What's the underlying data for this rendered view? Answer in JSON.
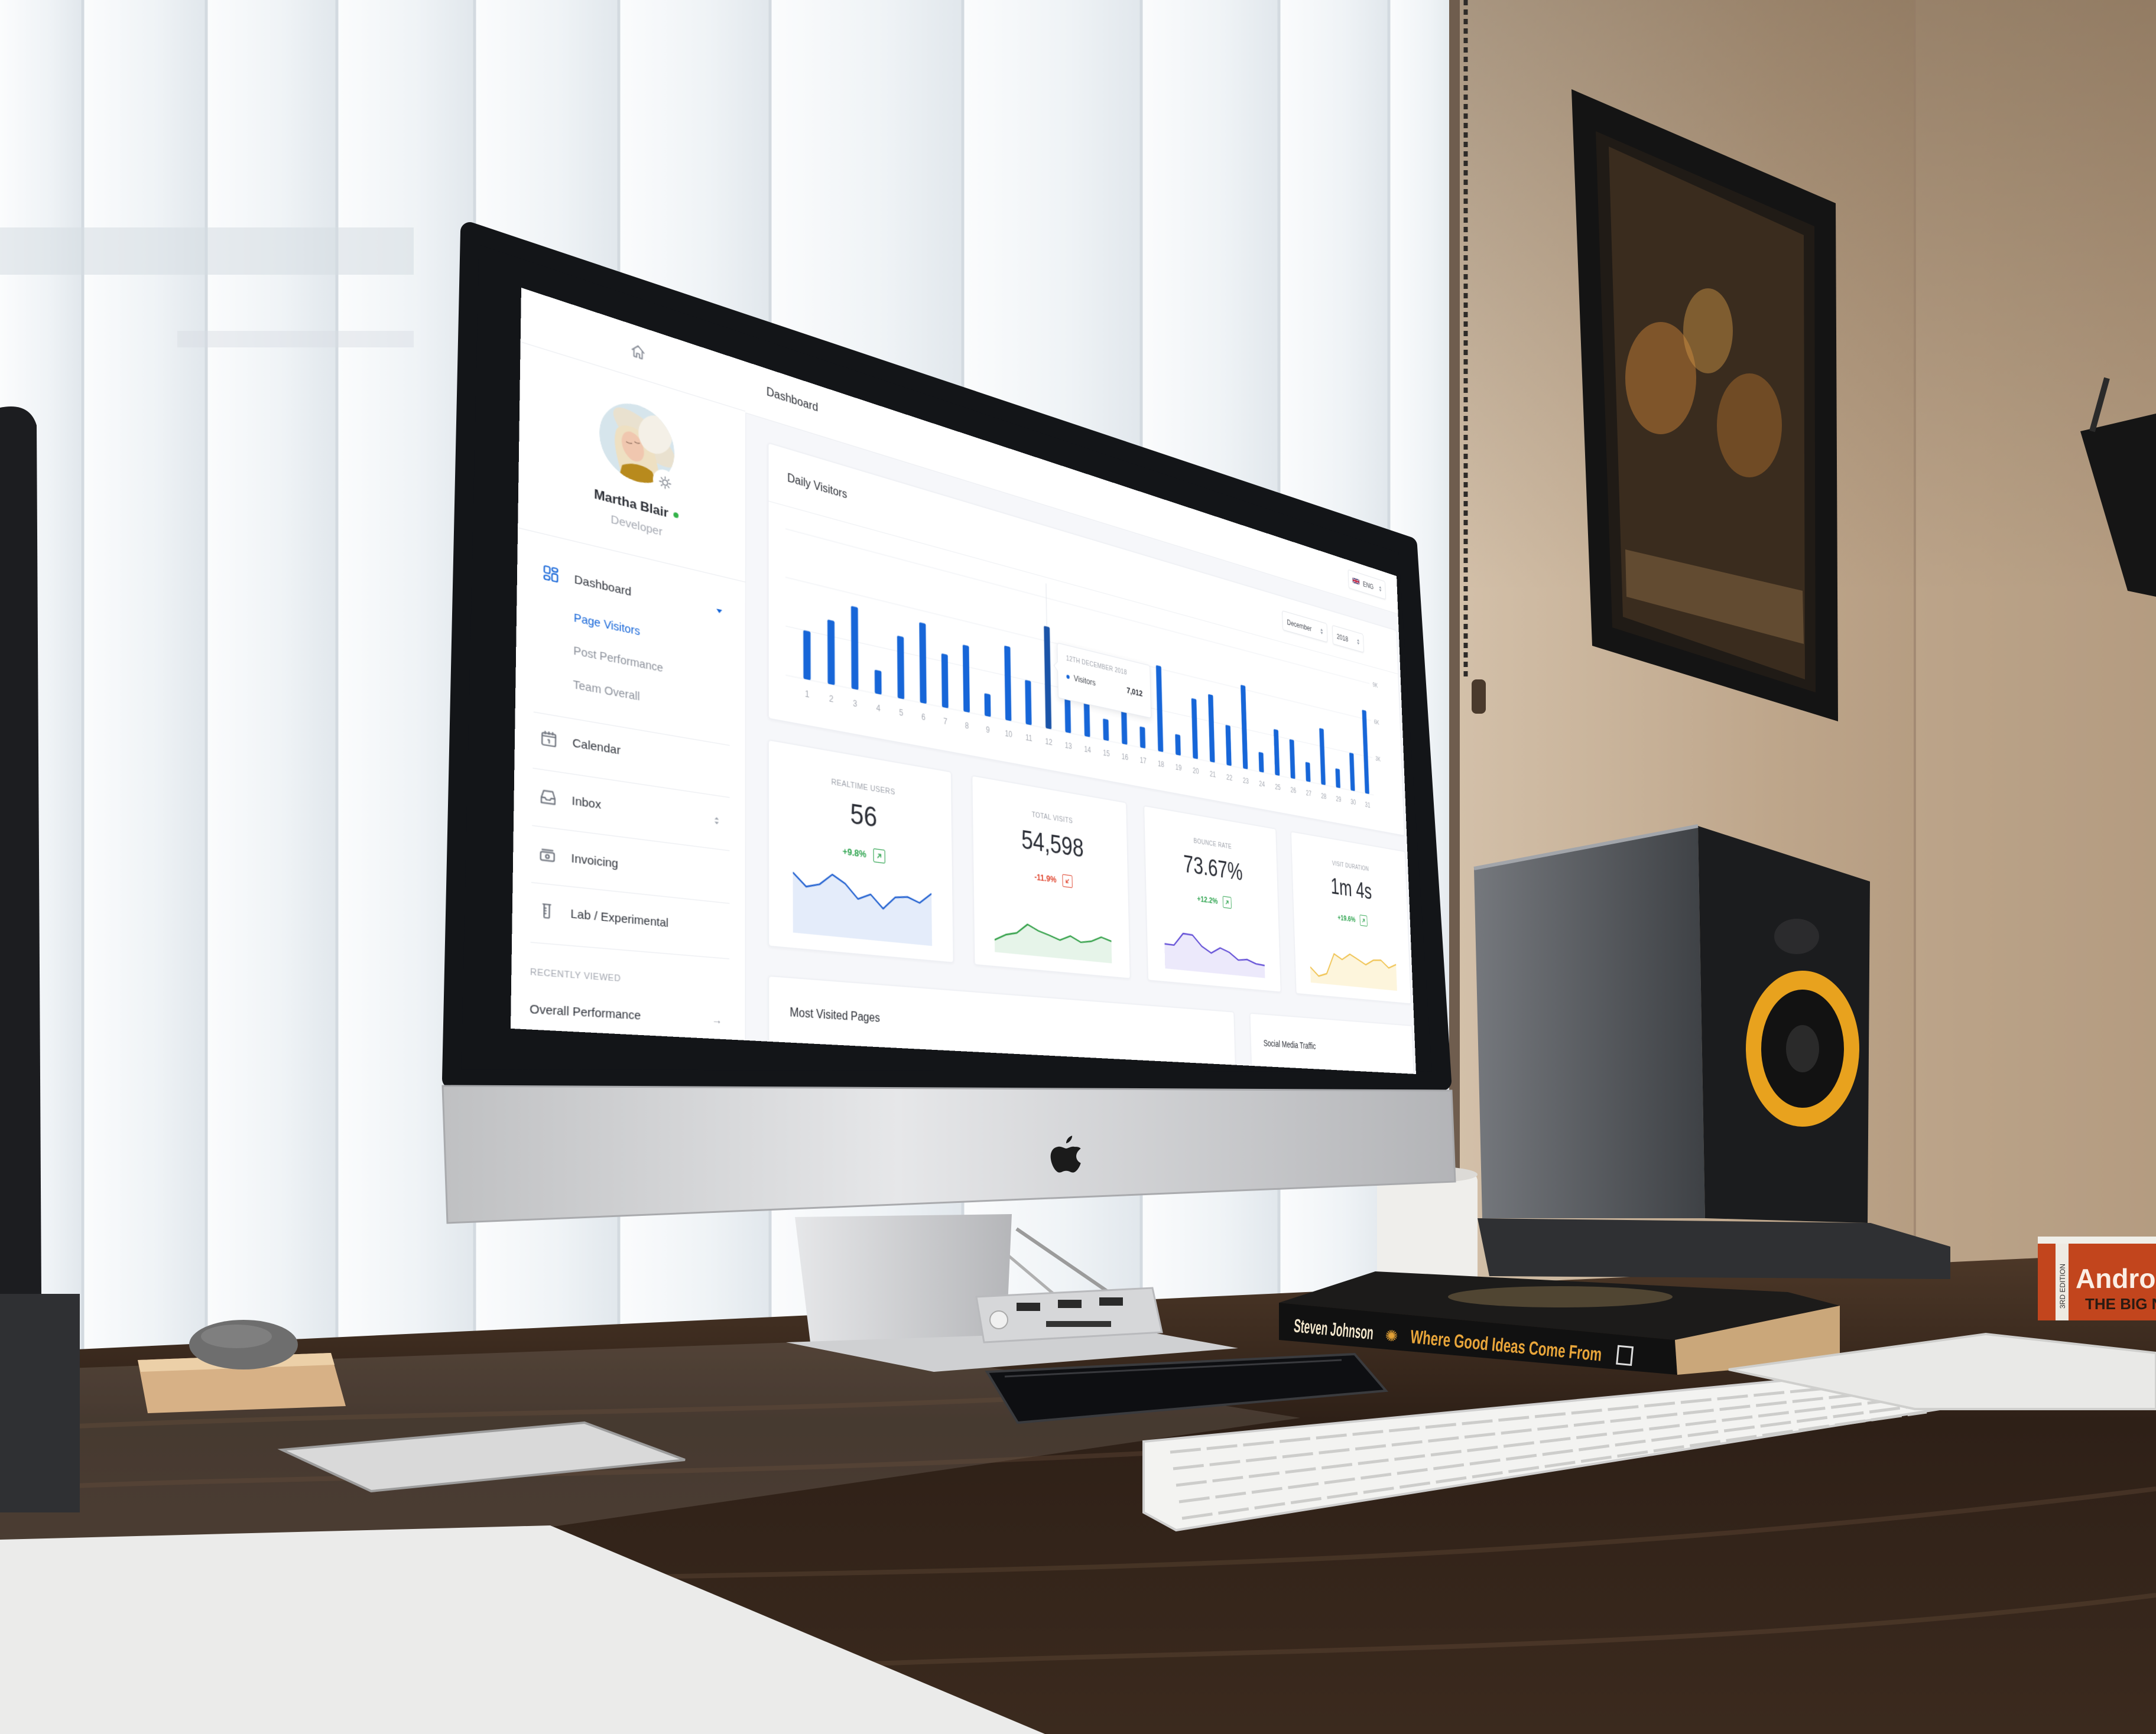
{
  "scene": {
    "book": {
      "author": "Steven Johnson",
      "title": "Where Good Ideas Come From"
    },
    "android_book": {
      "title": "Android",
      "subtitle": "THE BIG N",
      "edition": "3RD EDITION"
    }
  },
  "colors": {
    "brand": "#1565d8",
    "bar": "#1766d8",
    "bar_highlight": "#1b54a8",
    "positive": "#2ea44f",
    "negative": "#e0452f",
    "online": "#34b34a"
  },
  "sidebar": {
    "home_icon": "home-icon",
    "profile": {
      "name": "Martha Blair",
      "role": "Developer",
      "status": "online"
    },
    "nav": [
      {
        "label": "Dashboard",
        "icon": "dashboard-grid-icon",
        "expanded": true,
        "children": [
          {
            "label": "Page Visitors",
            "active": true
          },
          {
            "label": "Post Performance",
            "active": false
          },
          {
            "label": "Team Overall",
            "active": false
          }
        ]
      },
      {
        "label": "Calendar",
        "icon": "calendar-icon"
      },
      {
        "label": "Inbox",
        "icon": "inbox-icon"
      },
      {
        "label": "Invoicing",
        "icon": "money-icon"
      },
      {
        "label": "Lab / Experimental",
        "icon": "test-tube-icon"
      }
    ],
    "recently_viewed": {
      "heading": "RECENTLY VIEWED",
      "items": [
        {
          "label": "Overall Performance",
          "icon": "arrow-right-icon"
        }
      ]
    }
  },
  "header": {
    "title": "Dashboard",
    "language": {
      "value": "ENG",
      "flag": "uk-flag-icon"
    }
  },
  "daily_visitors": {
    "title": "Daily Visitors",
    "month": "December",
    "year": "2018",
    "tooltip": {
      "date": "12TH DECEMBER 2018",
      "series": "Visitors",
      "value": "7,012"
    }
  },
  "sparkline_range": [
    0,
    230
  ],
  "stats": [
    {
      "label": "REALTIME USERS",
      "value": "56",
      "change": "+9.8%",
      "trend": "up",
      "line_color": "#1f5fd0",
      "fill_color": "#e4ecfa",
      "sparkline": [
        203,
        160,
        173,
        212,
        186,
        138,
        159,
        114,
        159,
        165,
        149,
        187
      ]
    },
    {
      "label": "TOTAL VISITS",
      "value": "54,598",
      "change": "-11.9%",
      "trend": "down",
      "line_color": "#2e9e44",
      "fill_color": "#e6f4e9",
      "sparkline": [
        45,
        68,
        79,
        115,
        95,
        83,
        69,
        89,
        69,
        77,
        97,
        85
      ]
    },
    {
      "label": "BOUNCE RATE",
      "value": "73.67%",
      "change": "+12.2%",
      "trend": "up",
      "line_color": "#5a45d4",
      "fill_color": "#ece9fb",
      "sparkline": [
        98,
        97,
        148,
        146,
        104,
        81,
        106,
        92,
        64,
        70,
        56,
        53
      ]
    },
    {
      "label": "VISIT DURATION",
      "value": "1m 4s",
      "change": "+19.6%",
      "trend": "up",
      "line_color": "#efc04a",
      "fill_color": "#fdf5dc",
      "sparkline": [
        67,
        31,
        45,
        135,
        114,
        141,
        122,
        102,
        126,
        130,
        99,
        118
      ]
    }
  ],
  "panels": {
    "most_visited": "Most Visited Pages",
    "social_traffic": "Social Media Traffic"
  },
  "chart_data": {
    "type": "bar",
    "title": "Daily Visitors",
    "xlabel": "",
    "ylabel": "",
    "categories": [
      "1",
      "2",
      "3",
      "4",
      "5",
      "6",
      "7",
      "8",
      "9",
      "10",
      "11",
      "12",
      "13",
      "14",
      "15",
      "16",
      "17",
      "18",
      "19",
      "20",
      "21",
      "22",
      "23",
      "24",
      "25",
      "26",
      "27",
      "28",
      "29",
      "30",
      "31"
    ],
    "series": [
      {
        "name": "Visitors",
        "values": [
          3000,
          4000,
          5200,
          1500,
          4000,
          5200,
          3500,
          4400,
          1500,
          5000,
          3000,
          7012,
          3900,
          3400,
          1500,
          3000,
          1500,
          6200,
          1500,
          4400,
          5000,
          3000,
          6300,
          1500,
          3500,
          3000,
          1500,
          4400,
          1500,
          3000,
          6700
        ]
      }
    ],
    "ylim": [
      0,
      10000
    ],
    "y_ticks": [
      3000,
      6000,
      9000
    ],
    "y_tick_labels": [
      "3K",
      "6K",
      "9K"
    ],
    "y_axis_side": "right",
    "grid": true,
    "legend": "none",
    "highlighted_category": "12"
  }
}
